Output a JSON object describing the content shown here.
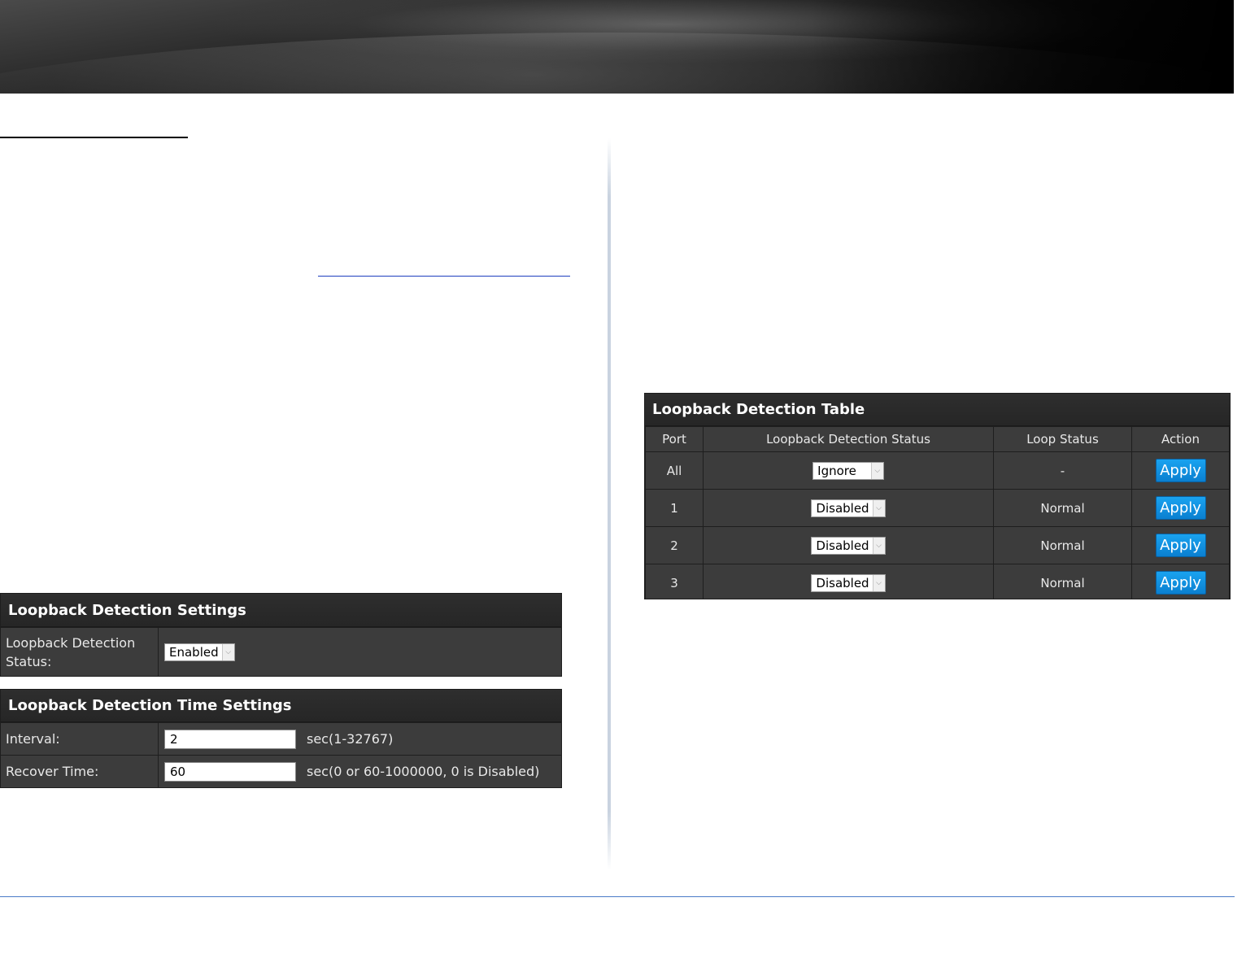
{
  "settings_panel": {
    "title": "Loopback Detection Settings",
    "status_label": "Loopback Detection Status:",
    "status_value": "Enabled"
  },
  "time_panel": {
    "title": "Loopback Detection Time Settings",
    "interval_label": "Interval:",
    "interval_value": "2",
    "interval_hint": "sec(1-32767)",
    "recover_label": "Recover Time:",
    "recover_value": "60",
    "recover_hint": "sec(0 or 60-1000000, 0 is Disabled)"
  },
  "table_panel": {
    "title": "Loopback Detection Table",
    "columns": [
      "Port",
      "Loopback Detection Status",
      "Loop Status",
      "Action"
    ],
    "rows": [
      {
        "port": "All",
        "status": "Ignore",
        "loop": "-",
        "action": "Apply"
      },
      {
        "port": "1",
        "status": "Disabled",
        "loop": "Normal",
        "action": "Apply"
      },
      {
        "port": "2",
        "status": "Disabled",
        "loop": "Normal",
        "action": "Apply"
      },
      {
        "port": "3",
        "status": "Disabled",
        "loop": "Normal",
        "action": "Apply"
      }
    ]
  },
  "colors": {
    "panel_bg": "#3c3c3c",
    "header_bg": "#282828",
    "button_blue": "#0a8fe0",
    "footer_rule": "#4a7bc8"
  }
}
